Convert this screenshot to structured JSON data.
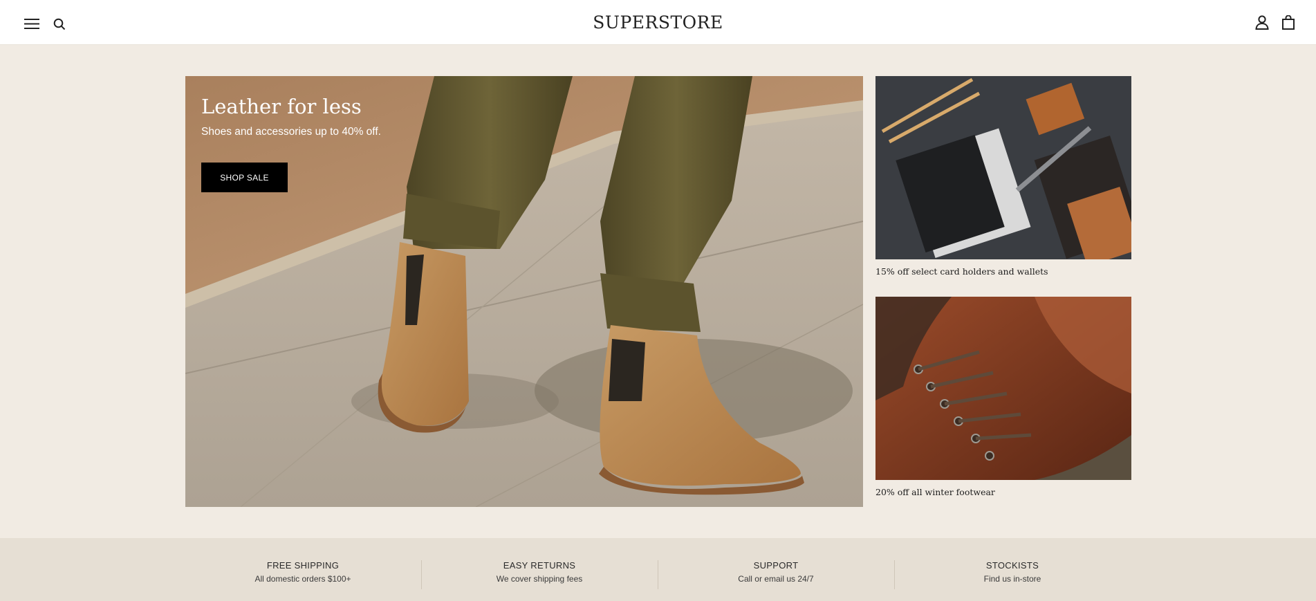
{
  "header": {
    "logo": "SUPERSTORE",
    "icons": [
      "menu-icon",
      "search-icon",
      "account-icon",
      "cart-icon"
    ]
  },
  "hero": {
    "title": "Leather for less",
    "subtitle": "Shoes and accessories up to 40% off.",
    "button_label": "SHOP SALE"
  },
  "promos": [
    {
      "caption": "15% off select card holders and wallets"
    },
    {
      "caption": "20% off all winter footwear"
    }
  ],
  "features": [
    {
      "title": "FREE SHIPPING",
      "subtitle": "All domestic orders $100+"
    },
    {
      "title": "EASY RETURNS",
      "subtitle": "We cover shipping fees"
    },
    {
      "title": "SUPPORT",
      "subtitle": "Call or email us 24/7"
    },
    {
      "title": "STOCKISTS",
      "subtitle": "Find us in-store"
    }
  ],
  "colors": {
    "page_background": "#f1ebe3",
    "feature_bar": "#e6dfd4",
    "button": "#000000",
    "header": "#ffffff"
  }
}
